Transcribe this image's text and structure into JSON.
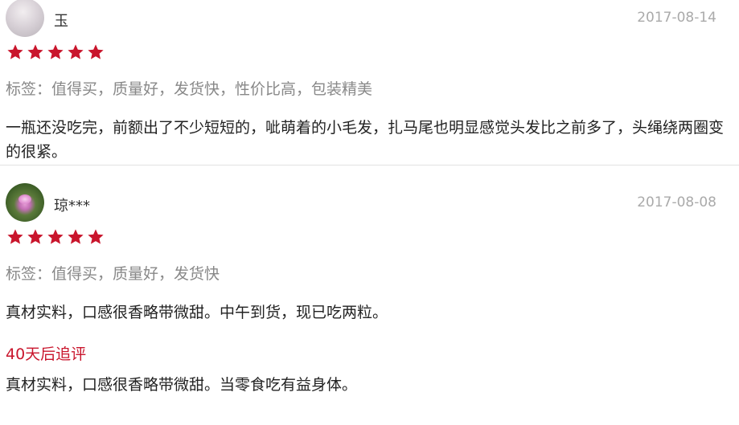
{
  "reviews": [
    {
      "username": "玉",
      "date": "2017-08-14",
      "rating": 5,
      "tags": "标签：值得买，质量好，发货快，性价比高，包装精美",
      "content": "一瓶还没吃完，前额出了不少短短的，呲萌着的小毛发，扎马尾也明显感觉头发比之前多了，头绳绕两圈变的很紧。"
    },
    {
      "username": "琼***",
      "date": "2017-08-08",
      "rating": 5,
      "tags": "标签：值得买，质量好，发货快",
      "content": "真材实料，口感很香略带微甜。中午到货，现已吃两粒。",
      "followup_title": "40天后追评",
      "followup_content": "真材实料，口感很香略带微甜。当零食吃有益身体。"
    }
  ],
  "colors": {
    "star": "#c9152c",
    "followup": "#c9152c",
    "tag_text": "#888888",
    "date_text": "#aaaaaa"
  },
  "icons": {
    "star": "star-icon"
  }
}
